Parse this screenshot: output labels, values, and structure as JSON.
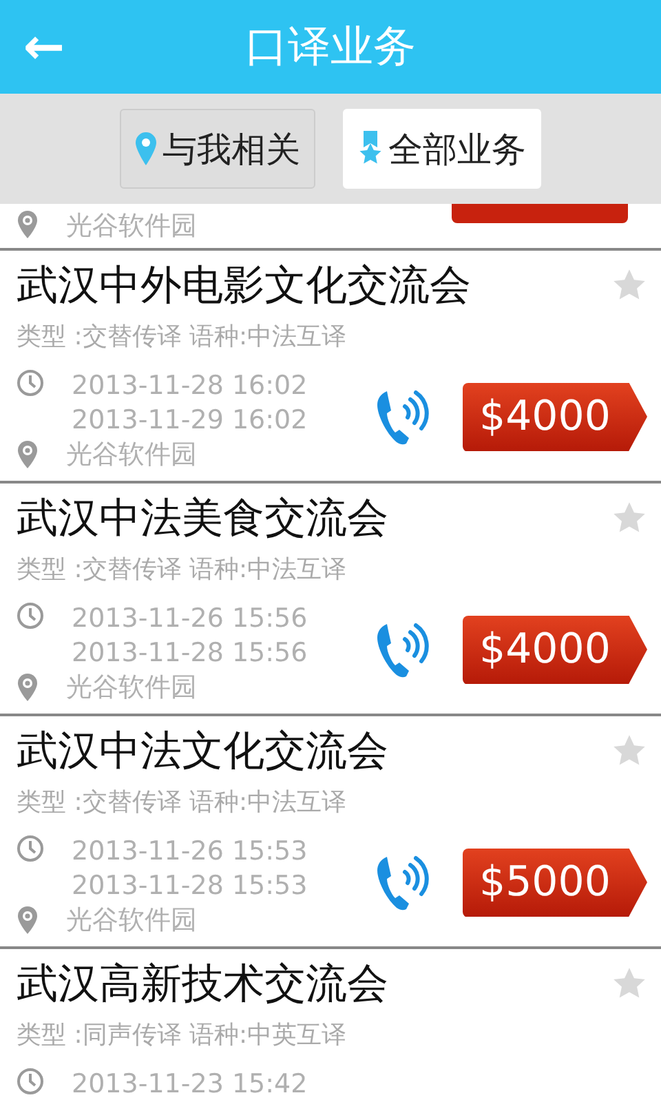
{
  "header": {
    "back": "←",
    "title": "口译业务"
  },
  "tabs": [
    {
      "label": "与我相关",
      "kind": "pin",
      "selected": false
    },
    {
      "label": "全部业务",
      "kind": "ribbon",
      "selected": true
    }
  ],
  "items": [
    {
      "kind": "partial",
      "location": "光谷软件园"
    },
    {
      "kind": "full",
      "title": "武汉中外电影文化交流会",
      "info": "类型 :交替传译 语种:中法互译",
      "start": "2013-11-28 16:02",
      "end": "2013-11-29 16:02",
      "location": "光谷软件园",
      "price": "$4000",
      "starred": false
    },
    {
      "kind": "full",
      "title": "武汉中法美食交流会",
      "info": "类型 :交替传译 语种:中法互译",
      "start": "2013-11-26 15:56",
      "end": "2013-11-28 15:56",
      "location": "光谷软件园",
      "price": "$4000",
      "starred": false
    },
    {
      "kind": "full",
      "title": "武汉中法文化交流会",
      "info": "类型 :交替传译 语种:中法互译",
      "start": "2013-11-26 15:53",
      "end": "2013-11-28 15:53",
      "location": "光谷软件园",
      "price": "$5000",
      "starred": false
    },
    {
      "kind": "cut",
      "title": "武汉高新技术交流会",
      "info": "类型 :同声传译 语种:中英互译",
      "start": "2013-11-23 15:42",
      "starred": false
    }
  ]
}
